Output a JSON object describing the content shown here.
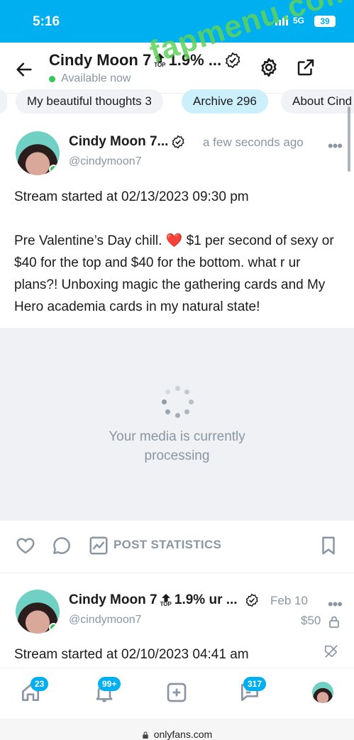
{
  "status_bar": {
    "time": "5:16",
    "network": "5G",
    "battery": "39"
  },
  "header": {
    "name": "Cindy Moon 7",
    "top_label": "TOP",
    "top_percent": "1.9% ...",
    "availability": "Available now"
  },
  "tabs": [
    {
      "label": "My beautiful thoughts 3"
    },
    {
      "label": "Archive 296"
    },
    {
      "label": "About Cind"
    }
  ],
  "posts": [
    {
      "name": "Cindy Moon 7...",
      "handle": "@cindymoon7",
      "time": "a few seconds ago",
      "text_line1": "Stream started at 02/13/2023 09:30 pm",
      "text_body": "Pre Valentine’s Day chill. ❤️ $1 per second of sexy or $40 for the top and $40 for the bottom. what r ur plans?! Unboxing magic the gathering cards and My Hero academia cards in my natural state!",
      "media_status": "Your media is currently processing"
    },
    {
      "name": "Cindy Moon 7",
      "top_label": "TOP",
      "top_percent": "1.9% ur ...",
      "handle": "@cindymoon7",
      "date": "Feb 10",
      "price": "$50",
      "text_line1": "Stream started at 02/10/2023 04:41 am"
    }
  ],
  "actions": {
    "stats_label": "POST STATISTICS"
  },
  "bottom_nav": {
    "home_badge": "23",
    "notif_badge": "99+",
    "messages_badge": "317"
  },
  "browser": {
    "url": "onlyfans.com"
  },
  "watermark": "fapmenu.com",
  "colors": {
    "brand": "#00aff0",
    "online": "#34c759",
    "muted": "#8a96a3",
    "heart": "#e0245e",
    "watermark": "#5fd35a"
  }
}
